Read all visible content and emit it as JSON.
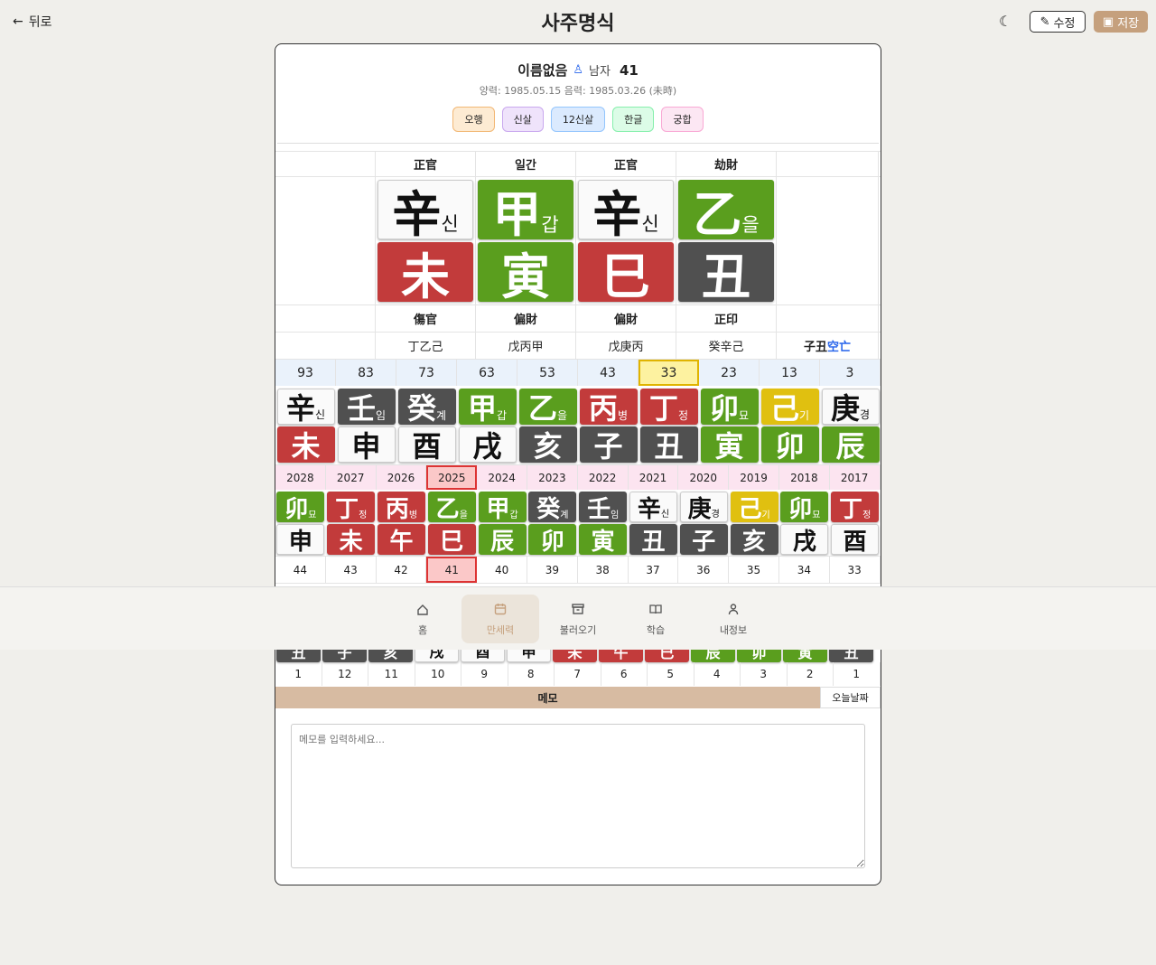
{
  "header": {
    "back_label": "뒤로",
    "title": "사주명식",
    "edit_label": "수정",
    "save_label": "저장"
  },
  "profile": {
    "name": "이름없음",
    "gender": "남자",
    "age": "41",
    "dates": "양력: 1985.05.15 음력: 1985.03.26 (未時)"
  },
  "tags": [
    {
      "label": "오행",
      "bg": "#fdebd3",
      "border": "#f2b774"
    },
    {
      "label": "신살",
      "bg": "#efe3fb",
      "border": "#c9a8ee"
    },
    {
      "label": "12신살",
      "bg": "#dbeafe",
      "border": "#93c5fd"
    },
    {
      "label": "한글",
      "bg": "#dcfce7",
      "border": "#86efac"
    },
    {
      "label": "궁합",
      "bg": "#fce7f3",
      "border": "#f9a8d4"
    }
  ],
  "pillars": {
    "top_labels": [
      "正官",
      "일간",
      "正官",
      "劫財"
    ],
    "stems": [
      {
        "h": "辛",
        "k": "신",
        "c": "white"
      },
      {
        "h": "甲",
        "k": "갑",
        "c": "green"
      },
      {
        "h": "辛",
        "k": "신",
        "c": "white"
      },
      {
        "h": "乙",
        "k": "을",
        "c": "green"
      }
    ],
    "branches": [
      {
        "h": "未",
        "c": "red"
      },
      {
        "h": "寅",
        "c": "green"
      },
      {
        "h": "巳",
        "c": "red"
      },
      {
        "h": "丑",
        "c": "dark"
      }
    ],
    "bottom_labels": [
      "傷官",
      "偏財",
      "偏財",
      "正印"
    ],
    "hidden": [
      "丁乙己",
      "戊丙甲",
      "戊庚丙",
      "癸辛己"
    ],
    "gongmang": "子丑",
    "gongmang_label": "空亡"
  },
  "daeun": {
    "ages": [
      "93",
      "83",
      "73",
      "63",
      "53",
      "43",
      "33",
      "23",
      "13",
      "3"
    ],
    "highlight": 6,
    "stems": [
      {
        "h": "辛",
        "k": "신",
        "c": "white"
      },
      {
        "h": "壬",
        "k": "임",
        "c": "dark"
      },
      {
        "h": "癸",
        "k": "계",
        "c": "dark"
      },
      {
        "h": "甲",
        "k": "갑",
        "c": "green"
      },
      {
        "h": "乙",
        "k": "을",
        "c": "green"
      },
      {
        "h": "丙",
        "k": "병",
        "c": "red"
      },
      {
        "h": "丁",
        "k": "정",
        "c": "red"
      },
      {
        "h": "卯",
        "k": "묘",
        "c": "green"
      },
      {
        "h": "己",
        "k": "기",
        "c": "yellow"
      },
      {
        "h": "庚",
        "k": "경",
        "c": "white"
      }
    ],
    "branches": [
      {
        "h": "未",
        "c": "red"
      },
      {
        "h": "申",
        "c": "white"
      },
      {
        "h": "酉",
        "c": "white"
      },
      {
        "h": "戌",
        "c": "white"
      },
      {
        "h": "亥",
        "c": "dark"
      },
      {
        "h": "子",
        "c": "dark"
      },
      {
        "h": "丑",
        "c": "dark"
      },
      {
        "h": "寅",
        "c": "green"
      },
      {
        "h": "卯",
        "c": "green"
      },
      {
        "h": "辰",
        "c": "green"
      }
    ]
  },
  "seun": {
    "years": [
      "2028",
      "2027",
      "2026",
      "2025",
      "2024",
      "2023",
      "2022",
      "2021",
      "2020",
      "2019",
      "2018",
      "2017"
    ],
    "highlight": 3,
    "stems": [
      {
        "h": "卯",
        "k": "묘",
        "c": "green"
      },
      {
        "h": "丁",
        "k": "정",
        "c": "red"
      },
      {
        "h": "丙",
        "k": "병",
        "c": "red"
      },
      {
        "h": "乙",
        "k": "을",
        "c": "green"
      },
      {
        "h": "甲",
        "k": "갑",
        "c": "green"
      },
      {
        "h": "癸",
        "k": "계",
        "c": "dark"
      },
      {
        "h": "壬",
        "k": "임",
        "c": "dark"
      },
      {
        "h": "辛",
        "k": "신",
        "c": "white"
      },
      {
        "h": "庚",
        "k": "경",
        "c": "white"
      },
      {
        "h": "己",
        "k": "기",
        "c": "yellow"
      },
      {
        "h": "卯",
        "k": "묘",
        "c": "green"
      },
      {
        "h": "丁",
        "k": "정",
        "c": "red"
      }
    ],
    "branches": [
      {
        "h": "申",
        "c": "white"
      },
      {
        "h": "未",
        "c": "red"
      },
      {
        "h": "午",
        "c": "red"
      },
      {
        "h": "巳",
        "c": "red"
      },
      {
        "h": "辰",
        "c": "green"
      },
      {
        "h": "卯",
        "c": "green"
      },
      {
        "h": "寅",
        "c": "green"
      },
      {
        "h": "丑",
        "c": "dark"
      },
      {
        "h": "子",
        "c": "dark"
      },
      {
        "h": "亥",
        "c": "dark"
      },
      {
        "h": "戌",
        "c": "white"
      },
      {
        "h": "酉",
        "c": "white"
      }
    ],
    "ages": [
      "44",
      "43",
      "42",
      "41",
      "40",
      "39",
      "38",
      "37",
      "36",
      "35",
      "34",
      "33"
    ]
  },
  "wolun": {
    "partial": [
      {
        "h": "丑",
        "c": "dark"
      },
      {
        "h": "子",
        "c": "dark"
      },
      {
        "h": "亥",
        "c": "dark"
      },
      {
        "h": "戌",
        "c": "white"
      },
      {
        "h": "酉",
        "c": "white"
      },
      {
        "h": "申",
        "c": "white"
      },
      {
        "h": "未",
        "c": "red"
      },
      {
        "h": "午",
        "c": "red"
      },
      {
        "h": "巳",
        "c": "red"
      },
      {
        "h": "辰",
        "c": "green"
      },
      {
        "h": "卯",
        "c": "green"
      },
      {
        "h": "寅",
        "c": "green"
      },
      {
        "h": "丑",
        "c": "dark"
      }
    ],
    "months": [
      "1",
      "12",
      "11",
      "10",
      "9",
      "8",
      "7",
      "6",
      "5",
      "4",
      "3",
      "2",
      "1"
    ]
  },
  "memo": {
    "label": "메모",
    "today_label": "오늘날짜",
    "placeholder": "메모를 입력하세요..."
  },
  "nav": [
    {
      "label": "홈",
      "icon": "home-icon"
    },
    {
      "label": "만세력",
      "icon": "calendar-icon",
      "active": true
    },
    {
      "label": "불러오기",
      "icon": "archive-icon"
    },
    {
      "label": "학습",
      "icon": "book-icon"
    },
    {
      "label": "내정보",
      "icon": "user-icon"
    }
  ]
}
